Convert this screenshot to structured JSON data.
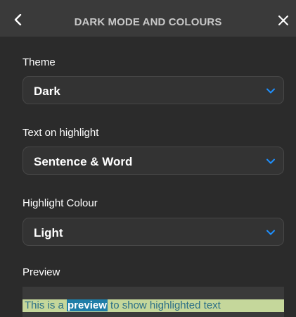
{
  "header": {
    "title": "DARK MODE AND COLOURS",
    "back_icon": "chevron-left-icon",
    "close_icon": "close-icon"
  },
  "theme": {
    "label": "Theme",
    "value": "Dark"
  },
  "text_on_highlight": {
    "label": "Text on highlight",
    "value": "Sentence & Word"
  },
  "highlight_colour": {
    "label": "Highlight Colour",
    "value": "Light"
  },
  "preview": {
    "label": "Preview",
    "text_before": "This is a ",
    "highlighted_word": "preview",
    "text_after": " to show highlighted text"
  },
  "colors": {
    "background": "#2b2b2b",
    "header": "#3a3a3a",
    "accent": "#1f7ea8",
    "chevron": "#1e90ff",
    "sentence_highlight": "#c5d79b"
  }
}
